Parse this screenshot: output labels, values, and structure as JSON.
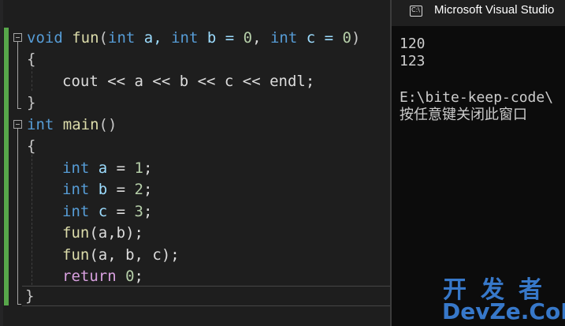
{
  "editor": {
    "lines": {
      "l1": {
        "kw_void": "void",
        "fn_name": "fun",
        "open": "(",
        "kw_int1": "int",
        "p_a": " a, ",
        "kw_int2": "int",
        "p_b": " b = ",
        "n0a": "0",
        "comma": ", ",
        "kw_int3": "int",
        "p_c": " c = ",
        "n0b": "0",
        "close": ")"
      },
      "l2": "{",
      "l3": "cout << a << b << c << endl;",
      "l4": "}",
      "l5": {
        "kw_int": "int",
        "fn_main": " main",
        "parens": "()"
      },
      "l6": "{",
      "l7": {
        "kw": "int",
        "id": " a",
        "op": " = ",
        "num": "1",
        "semi": ";"
      },
      "l8": {
        "kw": "int",
        "id": " b",
        "op": " = ",
        "num": "2",
        "semi": ";"
      },
      "l9": {
        "kw": "int",
        "id": " c",
        "op": " = ",
        "num": "3",
        "semi": ";"
      },
      "l10": {
        "fn": "fun",
        "args": "(a,b);"
      },
      "l11": {
        "fn": "fun",
        "args": "(a, b, c);"
      },
      "l12": {
        "ctl": "return",
        "sp": " ",
        "num": "0",
        "semi": ";"
      },
      "l13": "}"
    }
  },
  "console": {
    "title": "Microsoft Visual Studio",
    "icon_text": "C:\\",
    "output": [
      "120",
      "123",
      "",
      "E:\\bite-keep-code\\",
      "按任意键关闭此窗口"
    ]
  },
  "watermark": {
    "top": "开发者",
    "bottom": "DevZe.CoM"
  },
  "colors": {
    "keyword": "#569cd6",
    "function": "#dcdcaa",
    "identifier": "#9cdcfe",
    "number": "#b5cea8",
    "control": "#d8a0df",
    "change_bar": "#57a64a",
    "watermark": "#3a7ed4"
  },
  "icons": [
    "collapse-minus-icon",
    "console-app-icon"
  ]
}
